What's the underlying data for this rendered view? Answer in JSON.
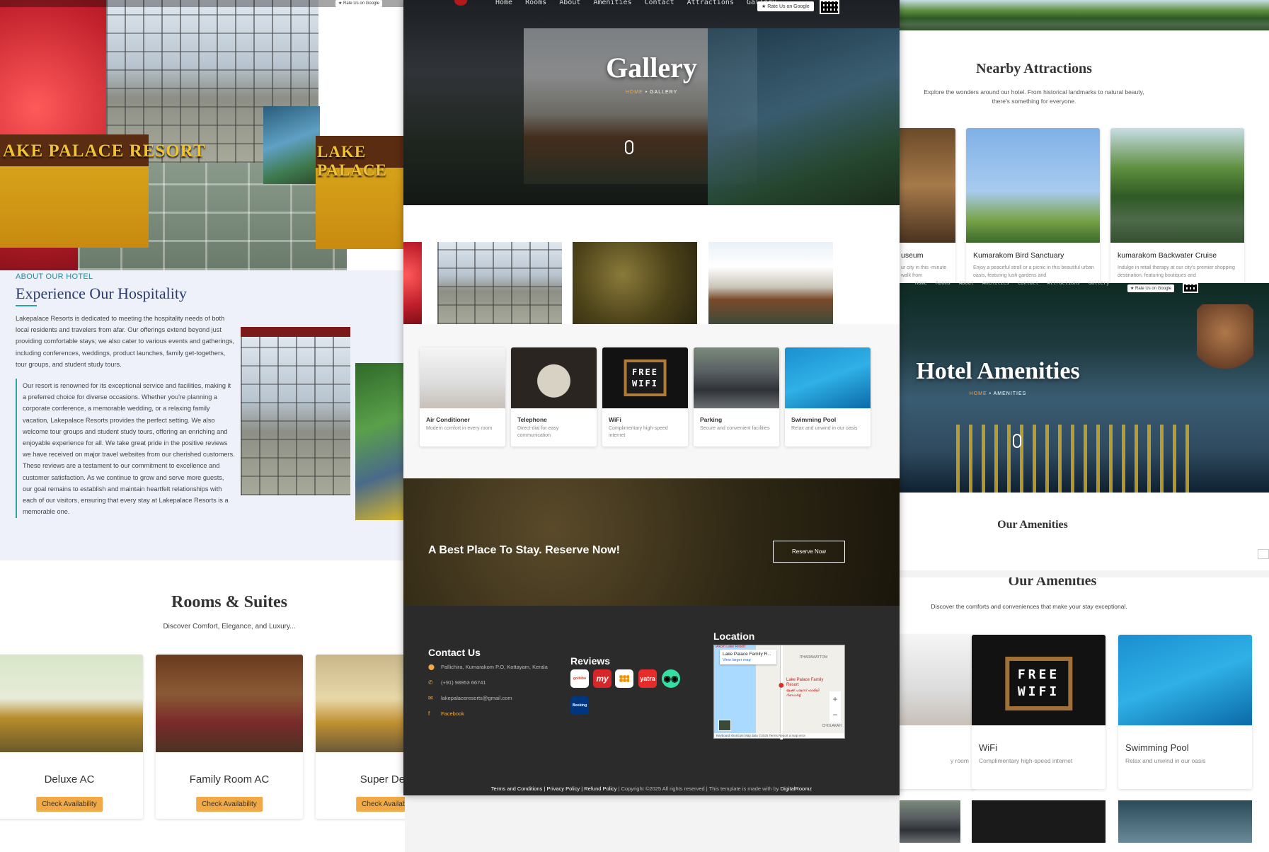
{
  "home": {
    "signs": [
      "AKE PALACE RESORT",
      "LAKE PALACE"
    ],
    "about": {
      "eyebrow": "ABOUT OUR HOTEL",
      "title": "Experience Our Hospitality",
      "para1": "Lakepalace Resorts is dedicated to meeting the hospitality needs of both local residents and travelers from afar. Our offerings extend beyond just providing comfortable stays; we also cater to various events and gatherings, including conferences, weddings, product launches, family get-togethers, tour groups, and student study tours.",
      "para2": "Our resort is renowned for its exceptional service and facilities, making it a preferred choice for diverse occasions. Whether you're planning a corporate conference, a memorable wedding, or a relaxing family vacation, Lakepalace Resorts provides the perfect setting. We also welcome tour groups and student study tours, offering an enriching and enjoyable experience for all. We take great pride in the positive reviews we have received on major travel websites from our cherished customers. These reviews are a testament to our commitment to excellence and customer satisfaction. As we continue to grow and serve more guests, our goal remains to establish and maintain heartfelt relationships with each of our visitors, ensuring that every stay at Lakepalace Resorts is a memorable one."
    },
    "rooms": {
      "title": "Rooms & Suites",
      "subtitle": "Discover Comfort, Elegance, and Luxury...",
      "cards": [
        {
          "name": "Deluxe AC",
          "button": "Check Availability"
        },
        {
          "name": "Family Room AC",
          "button": "Check Availability"
        },
        {
          "name": "Super Delux",
          "button": "Check Availability"
        }
      ]
    }
  },
  "gallery_page": {
    "nav": [
      "Home",
      "Rooms",
      "About",
      "Amenities",
      "Contact",
      "Attractions",
      "Gallery"
    ],
    "rate_pill": "★ Rate Us on Google",
    "title": "Gallery",
    "breadcrumb_home": "HOME",
    "breadcrumb_sep": "•",
    "breadcrumb_current": "GALLERY",
    "amenities": [
      {
        "title": "Air Conditioner",
        "desc": "Modern comfort in every room"
      },
      {
        "title": "Telephone",
        "desc": "Direct-dial for easy communication"
      },
      {
        "title": "WiFi",
        "desc": "Complimentary high-speed internet"
      },
      {
        "title": "Parking",
        "desc": "Secure and convenient facilities"
      },
      {
        "title": "Swimming Pool",
        "desc": "Relax and unwind in our oasis"
      }
    ],
    "wifi_sign": [
      "FREE",
      "WIFI"
    ],
    "cta": {
      "text": "A Best Place To Stay. Reserve Now!",
      "button": "Reserve Now"
    },
    "footer": {
      "contact_title": "Contact Us",
      "address": "Pallichira, Kumarakom P.O, Kottayam, Kerala",
      "phone": "(+91) 98953 66741",
      "email": "lakepalaceresorts@gmail.com",
      "facebook": "Facebook",
      "reviews_title": "Reviews",
      "review_sites": [
        "goibibo",
        "my",
        "trivago",
        "yatra",
        "tripadvisor",
        "Booking"
      ],
      "location_title": "Location",
      "map": {
        "card_title": "Lake Palace Family R...",
        "card_link": "View larger map",
        "pin_label": "Lake Palace Family Resort",
        "pin_label_ml": "ലേക്ക് പാലസ് ഫാമിലി റിസോർട്ട്",
        "top_label": "lAkom Lake Resort",
        "area_label": "ITHARAMATTOM",
        "area2_label": "CHOLAKAH",
        "attribution": "Keyboard shortcuts   Map data ©2025   Terms   Report a map error"
      },
      "copyright_links": "Terms and Conditions | Privacy Policy | Refund Policy",
      "copyright_text": " | Copyright ©2025 All rights reserved | This template is made with by ",
      "copyright_brand": "DigitalRoomz"
    }
  },
  "right_pages": {
    "nearby": {
      "title": "Nearby Attractions",
      "subtitle": "Explore the wonders around our hotel. From historical landmarks to natural beauty, there's something for everyone.",
      "cards": [
        {
          "title": "useum",
          "desc": "ur city in this -minute walk from"
        },
        {
          "title": "Kumarakom Bird Sanctuary",
          "desc": "Enjoy a peaceful stroll or a picnic in this beautiful urban oasis, featuring lush gardens and"
        },
        {
          "title": "kumarakom Backwater Cruise",
          "desc": "Indulge in retail therapy at our city's premier shopping destination, featuring boutiques and"
        }
      ]
    },
    "amenities_page": {
      "nav": [
        "Home",
        "Rooms",
        "About",
        "Amenities",
        "Contact",
        "Attractions",
        "Gallery"
      ],
      "rate_pill": "★ Rate Us on Google",
      "title": "Hotel Amenities",
      "breadcrumb_home": "HOME",
      "breadcrumb_sep": "•",
      "breadcrumb_current": "AMENITIES",
      "section_title": "Our Amenities",
      "section_title2": "Our Amenities",
      "section_sub": "Discover the comforts and conveniences that make your stay exceptional.",
      "cards": [
        {
          "title": "",
          "desc": "y room"
        },
        {
          "title": "WiFi",
          "desc": "Complimentary high-speed internet"
        },
        {
          "title": "Swimming Pool",
          "desc": "Relax and unwind in our oasis"
        }
      ],
      "wifi_sign": [
        "FREE",
        "WIFI"
      ]
    }
  }
}
